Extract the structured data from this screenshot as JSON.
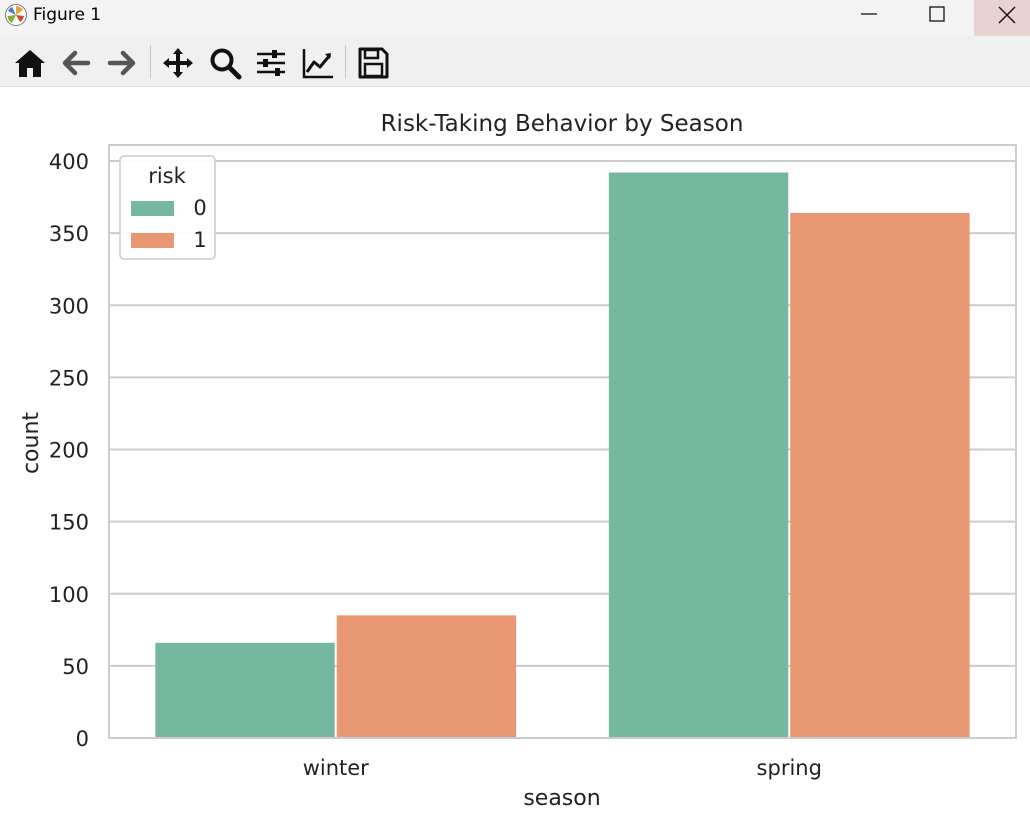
{
  "window": {
    "title": "Figure 1"
  },
  "toolbar": {
    "buttons": [
      {
        "icon": "home-icon"
      },
      {
        "icon": "back-icon"
      },
      {
        "icon": "forward-icon"
      },
      {
        "icon": "pan-icon"
      },
      {
        "icon": "zoom-icon"
      },
      {
        "icon": "configure-subplots-icon"
      },
      {
        "icon": "edit-axis-icon"
      },
      {
        "icon": "save-icon"
      }
    ]
  },
  "chart_data": {
    "type": "bar",
    "title": "Risk-Taking Behavior by Season",
    "xlabel": "season",
    "ylabel": "count",
    "categories": [
      "winter",
      "spring"
    ],
    "series": [
      {
        "name": "0",
        "values": [
          66,
          392
        ],
        "color": "#76b7a0"
      },
      {
        "name": "1",
        "values": [
          85,
          364
        ],
        "color": "#e99773"
      }
    ],
    "legend_title": "risk",
    "legend_placement": "top-left",
    "ylim": [
      0,
      400
    ],
    "yticks": [
      0,
      50,
      100,
      150,
      200,
      250,
      300,
      350,
      400
    ],
    "grid": true
  }
}
